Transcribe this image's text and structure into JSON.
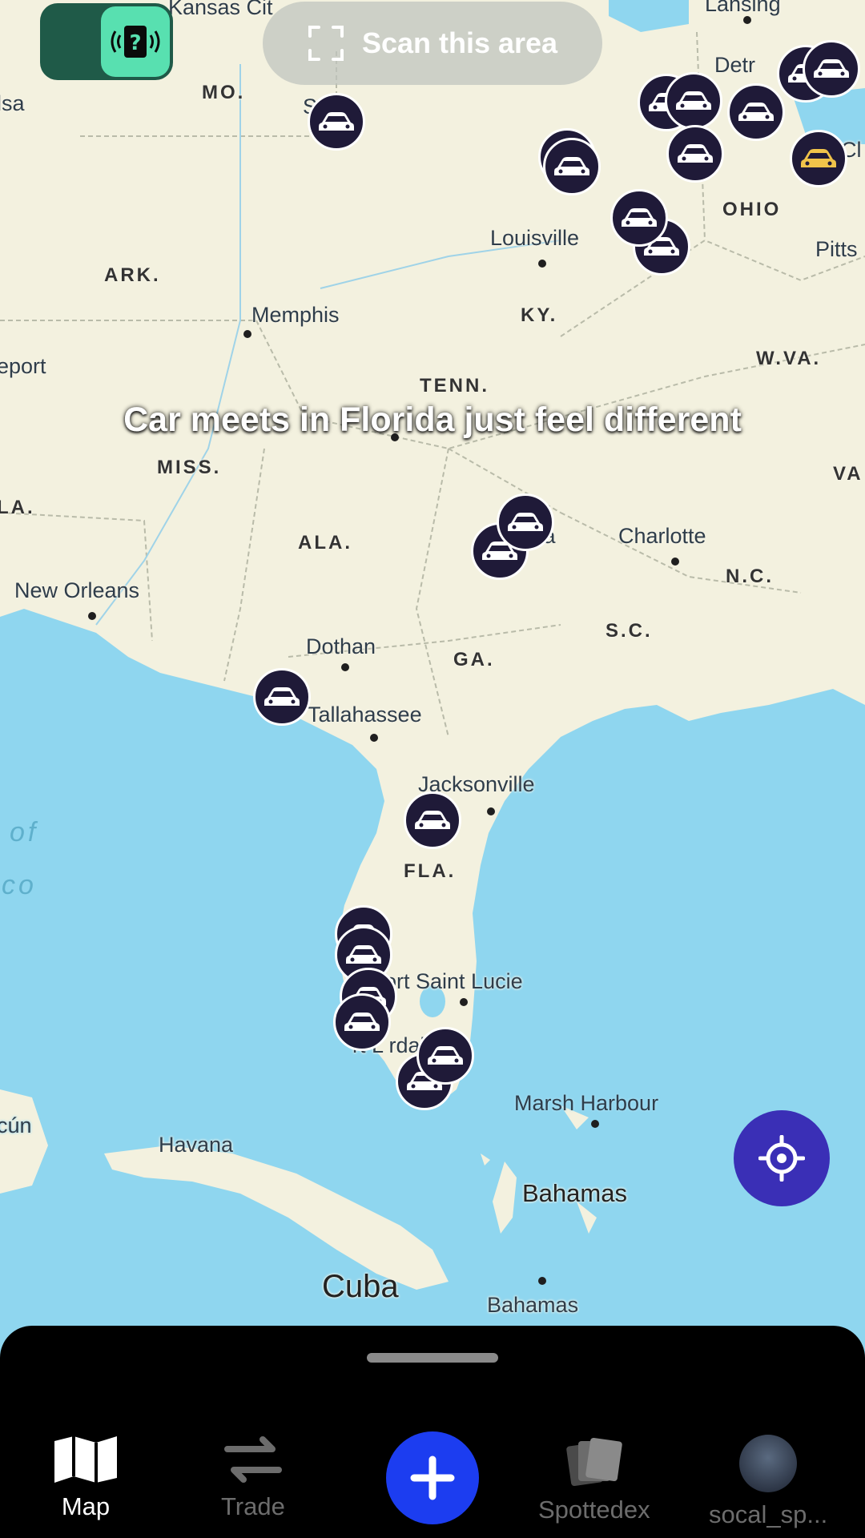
{
  "top_bar": {
    "scan_button_label": "Scan this area",
    "mode_toggle_icon": "question-signal-icon"
  },
  "caption": "Car meets in Florida just feel different",
  "map": {
    "cities": [
      "Kansas City",
      "Lansing",
      "Detroit",
      "Tulsa",
      "St. Louis",
      "Louisville",
      "Pittsburgh",
      "Memphis",
      "Shreveport",
      "New Orleans",
      "Dothan",
      "Tallahassee",
      "Charlotte",
      "Atlanta",
      "Jacksonville",
      "Port Saint Lucie",
      "Fort Lauderdale",
      "Marsh Harbour",
      "Havana",
      "Cancún"
    ],
    "states": [
      "MO.",
      "ARK.",
      "KY.",
      "OHIO",
      "W.VA.",
      "TENN.",
      "MISS.",
      "ALA.",
      "GA.",
      "S.C.",
      "N.C.",
      "VA",
      "FLA.",
      "LA."
    ],
    "countries": [
      "Cuba",
      "Bahamas",
      "Bahamas"
    ],
    "visible_labels": {
      "kansas": "Kansas Cit",
      "lansing": "Lansing",
      "detroit": "Detr",
      "tulsa": "lsa",
      "stlouis": "S    uis",
      "louisville": "Louisville",
      "pittsburgh": "Pitts",
      "memphis": "Memphis",
      "shreveport": "eport",
      "neworleans": "New Orleans",
      "dothan": "Dothan",
      "tallahassee": "Tallahassee",
      "charlotte": "Charlotte",
      "atlanta": "nta",
      "jacksonville": "Jacksonville",
      "portstlucie": "ort Saint Lucie",
      "ftlauderdale": "rt L      rdale",
      "marshharbour": "Marsh Harbour",
      "havana": "Havana",
      "cancun": "cún",
      "cl": "Cl",
      "gulf_of": "of",
      "gulf_co": "co",
      "mo": "MO.",
      "ark": "ARK.",
      "ky": "KY.",
      "ohio": "OHIO",
      "wva": "W.VA.",
      "tenn": "TENN.",
      "miss": "MISS.",
      "ala": "ALA.",
      "ga": "GA.",
      "sc": "S.C.",
      "nc": "N.C.",
      "va": "VA",
      "fla": "FLA.",
      "la": "LA.",
      "cuba": "Cuba",
      "bahamas1": "Bahamas",
      "bahamas2": "Bahamas"
    },
    "marker_icon": "car-icon",
    "marker_count": 26,
    "colors": {
      "land": "#f3f1df",
      "water": "#8fd6ef",
      "marker": "#1f1a38",
      "gold_marker": "#f0c34a"
    }
  },
  "locate_button_icon": "crosshair-icon",
  "bottom_nav": {
    "items": [
      {
        "label": "Map",
        "icon": "map-icon",
        "active": true
      },
      {
        "label": "Trade",
        "icon": "swap-arrows-icon",
        "active": false
      },
      {
        "label": "",
        "icon": "plus-icon",
        "active": false
      },
      {
        "label": "Spottedex",
        "icon": "cards-icon",
        "active": false
      },
      {
        "label": "socal_sp...",
        "icon": "avatar",
        "active": false
      }
    ]
  },
  "colors": {
    "accent_blue": "#1c3df0",
    "locate_purple": "#3a2fb6",
    "toggle_green": "#58e0b0"
  }
}
